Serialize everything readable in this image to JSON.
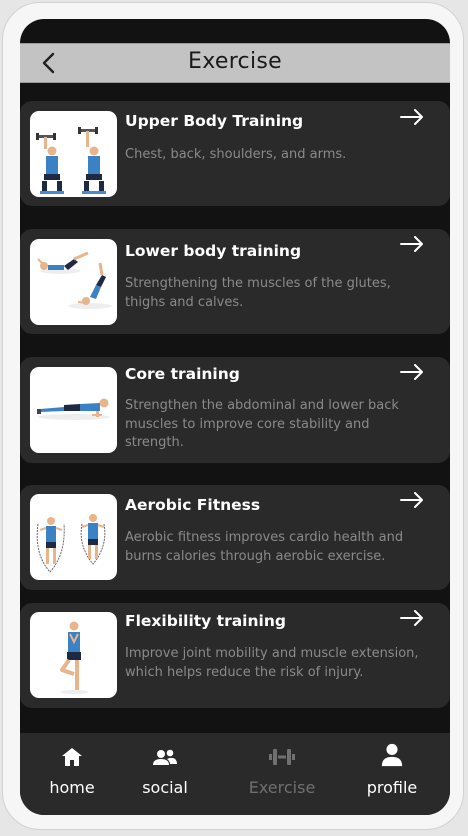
{
  "header": {
    "title": "Exercise"
  },
  "exercises": [
    {
      "title": "Upper Body Training",
      "description": "Chest, back, shoulders, and arms."
    },
    {
      "title": "Lower body training",
      "description": "Strengthening the muscles of the glutes, thighs and calves."
    },
    {
      "title": "Core training",
      "description": "Strengthen the abdominal and lower back muscles to improve core stability and strength."
    },
    {
      "title": "Aerobic Fitness",
      "description": "Aerobic fitness improves cardio health and burns calories through aerobic exercise."
    },
    {
      "title": "Flexibility training",
      "description": "Improve joint mobility and muscle extension, which helps reduce the risk of injury."
    }
  ],
  "tabbar": {
    "tabs": [
      {
        "label": "home",
        "icon": "home-icon"
      },
      {
        "label": "social",
        "icon": "people-icon"
      },
      {
        "label": "Exercise",
        "icon": "dumbbell-icon",
        "active": true
      },
      {
        "label": "profile",
        "icon": "user-icon"
      }
    ]
  },
  "colors": {
    "card": "#2a2a2a",
    "header": "#c3c3c3",
    "active_tab": "#707070"
  }
}
